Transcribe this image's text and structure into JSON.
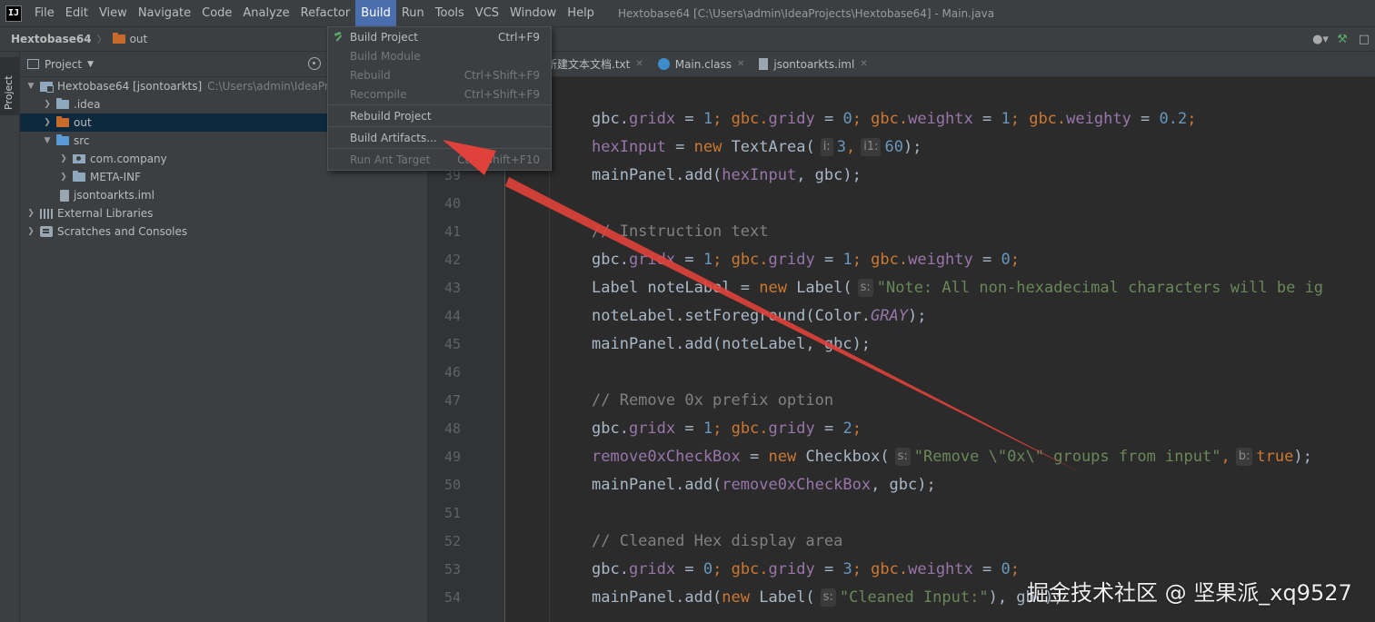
{
  "menubar": {
    "logo": "IJ",
    "items": [
      "File",
      "Edit",
      "View",
      "Navigate",
      "Code",
      "Analyze",
      "Refactor",
      "Build",
      "Run",
      "Tools",
      "VCS",
      "Window",
      "Help"
    ],
    "active": "Build",
    "window_title": "Hextobase64 [C:\\Users\\admin\\IdeaProjects\\Hextobase64] - Main.java"
  },
  "navbar": {
    "project": "Hextobase64",
    "folder": "out"
  },
  "toolstrip": {
    "project_tab": "Project"
  },
  "project_panel": {
    "title": "Project",
    "tree": [
      {
        "label": "Hextobase64 [jsontoarkts]",
        "path": "C:\\Users\\admin\\IdeaPr",
        "arrow": "expanded"
      },
      {
        "label": ".idea",
        "arrow": "collapsed"
      },
      {
        "label": "out",
        "arrow": "collapsed"
      },
      {
        "label": "src",
        "arrow": "expanded"
      },
      {
        "label": "com.company",
        "arrow": "collapsed"
      },
      {
        "label": "META-INF",
        "arrow": "collapsed"
      },
      {
        "label": "jsontoarkts.iml"
      },
      {
        "label": "External Libraries",
        "arrow": "collapsed"
      },
      {
        "label": "Scratches and Consoles",
        "arrow": "collapsed"
      }
    ]
  },
  "tabs": [
    {
      "label": "新建文本文档.txt"
    },
    {
      "label": "Main.class"
    },
    {
      "label": "jsontoarkts.iml"
    }
  ],
  "build_menu": {
    "items": [
      {
        "label": "Build Project",
        "shortcut": "Ctrl+F9",
        "enabled": true
      },
      {
        "label": "Build Module",
        "shortcut": "",
        "enabled": false
      },
      {
        "label": "Rebuild",
        "shortcut": "Ctrl+Shift+F9",
        "enabled": false
      },
      {
        "label": "Recompile",
        "shortcut": "Ctrl+Shift+F9",
        "enabled": false
      },
      {
        "label": "Rebuild Project",
        "shortcut": "",
        "enabled": true
      },
      {
        "label": "Build Artifacts...",
        "shortcut": "",
        "enabled": true
      },
      {
        "label": "Run Ant Target",
        "shortcut": "Ctrl+Shift+F10",
        "enabled": false
      }
    ]
  },
  "editor": {
    "line_numbers": [
      "39",
      "40",
      "41",
      "42",
      "43",
      "44",
      "45",
      "46",
      "47",
      "48",
      "49",
      "50",
      "51",
      "52",
      "53",
      "54"
    ],
    "hints": {
      "rows": "i:",
      "cols": "i1:",
      "s": "s:",
      "b": "b:"
    },
    "code": {
      "l37_a": "gbc.",
      "l37_f1": "gridx",
      "l37_b": " = ",
      "l37_n1": "1",
      "l37_c": "; gbc.",
      "l37_f2": "gridy",
      "l37_d": " = ",
      "l37_n2": "0",
      "l37_e": "; gbc.",
      "l37_f3": "weightx",
      "l37_g": " = ",
      "l37_n3": "1",
      "l37_h": "; gbc.",
      "l37_f4": "weighty",
      "l37_i": " = ",
      "l37_n4": "0.2",
      "l37_j": ";",
      "l38_f": "hexInput",
      "l38_a": " = ",
      "l38_k": "new",
      "l38_b": " TextArea(",
      "l38_n1": "3",
      "l38_c": ",",
      "l38_n2": "60",
      "l38_d": ");",
      "l39_a": "mainPanel.add(",
      "l39_f": "hexInput",
      "l39_b": ", gbc);",
      "l41_c": "// Instruction text",
      "l42_a": "gbc.",
      "l42_f1": "gridx",
      "l42_b": " = ",
      "l42_n1": "1",
      "l42_c": "; gbc.",
      "l42_f2": "gridy",
      "l42_d": " = ",
      "l42_n2": "1",
      "l42_e": "; gbc.",
      "l42_f3": "weighty",
      "l42_g": " = ",
      "l42_n3": "0",
      "l42_h": ";",
      "l43_a": "Label noteLabel = ",
      "l43_k": "new",
      "l43_b": " Label(",
      "l43_s": "\"Note: All non-hexadecimal characters will be ig",
      "l44_a": "noteLabel.setForeground(Color.",
      "l44_g": "GRAY",
      "l44_b": ");",
      "l45_a": "mainPanel.add(noteLabel, gbc);",
      "l47_c": "// Remove 0x prefix option",
      "l48_a": "gbc.",
      "l48_f1": "gridx",
      "l48_b": " = ",
      "l48_n1": "1",
      "l48_c": "; gbc.",
      "l48_f2": "gridy",
      "l48_d": " = ",
      "l48_n2": "2",
      "l48_e": ";",
      "l49_f": "remove0xCheckBox",
      "l49_a": " = ",
      "l49_k1": "new",
      "l49_b": " Checkbox(",
      "l49_s": "\"Remove \\\"0x\\\" groups from input\"",
      "l49_c": ",",
      "l49_k2": "true",
      "l49_d": ");",
      "l50_a": "mainPanel.add(",
      "l50_f": "remove0xCheckBox",
      "l50_b": ", gbc);",
      "l52_c": "// Cleaned Hex display area",
      "l53_a": "gbc.",
      "l53_f1": "gridx",
      "l53_b": " = ",
      "l53_n1": "0",
      "l53_c": "; gbc.",
      "l53_f2": "gridy",
      "l53_d": " = ",
      "l53_n2": "3",
      "l53_e": "; gbc.",
      "l53_f3": "weightx",
      "l53_g": " = ",
      "l53_n3": "0",
      "l53_h": ";",
      "l54_a": "mainPanel.add(",
      "l54_k": "new",
      "l54_b": " Label(",
      "l54_s": "\"Cleaned Input:\"",
      "l54_c": "), gbc);"
    }
  },
  "watermark": "掘金技术社区 @ 坚果派_xq9527",
  "colors": {
    "annotation_arrow": "#e0413a",
    "menu_highlight": "#4b6eaf"
  }
}
